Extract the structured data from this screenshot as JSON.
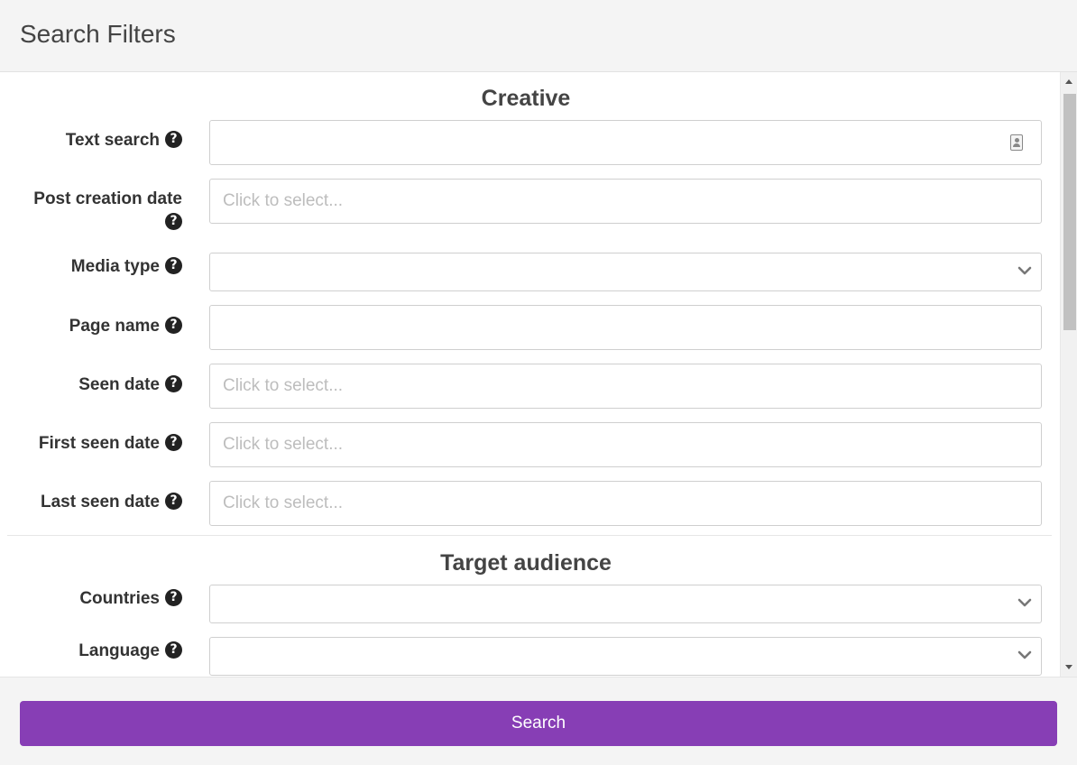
{
  "header": {
    "title": "Search Filters"
  },
  "sections": {
    "creative": {
      "title": "Creative"
    },
    "target_audience": {
      "title": "Target audience"
    }
  },
  "fields": {
    "text_search": {
      "label": "Text search",
      "value": "",
      "help_icon": "question-circle-icon",
      "trailing_icon": "contact-card-icon"
    },
    "post_creation_date": {
      "label": "Post creation date",
      "placeholder": "Click to select...",
      "help_icon": "question-circle-icon"
    },
    "media_type": {
      "label": "Media type",
      "value": "",
      "help_icon": "question-circle-icon",
      "trailing_icon": "chevron-down-icon"
    },
    "page_name": {
      "label": "Page name",
      "value": "",
      "help_icon": "question-circle-icon"
    },
    "seen_date": {
      "label": "Seen date",
      "placeholder": "Click to select...",
      "help_icon": "question-circle-icon"
    },
    "first_seen_date": {
      "label": "First seen date",
      "placeholder": "Click to select...",
      "help_icon": "question-circle-icon"
    },
    "last_seen_date": {
      "label": "Last seen date",
      "placeholder": "Click to select...",
      "help_icon": "question-circle-icon"
    },
    "countries": {
      "label": "Countries",
      "value": "",
      "help_icon": "question-circle-icon",
      "trailing_icon": "chevron-down-icon"
    },
    "language": {
      "label": "Language",
      "value": "",
      "help_icon": "question-circle-icon",
      "trailing_icon": "chevron-down-icon"
    }
  },
  "footer": {
    "search_label": "Search"
  },
  "colors": {
    "accent": "#873eb5",
    "header_bg": "#f4f4f4",
    "border": "#cfcfcf",
    "placeholder": "#bdbdbd"
  }
}
